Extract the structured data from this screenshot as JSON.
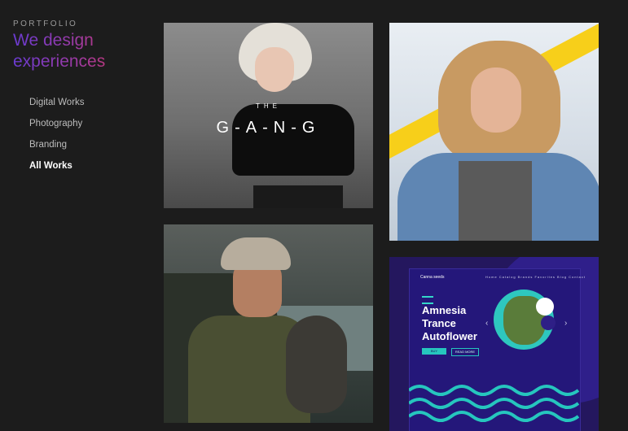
{
  "sidebar": {
    "eyebrow": "PORTFOLIO",
    "headline_line1": "We design",
    "headline_line2": "experiences",
    "nav": [
      {
        "label": "Digital Works",
        "active": false
      },
      {
        "label": "Photography",
        "active": false
      },
      {
        "label": "Branding",
        "active": false
      },
      {
        "label": "All Works",
        "active": true
      }
    ]
  },
  "tiles": {
    "gang": {
      "line1": "THE",
      "line2": "G-A-N-G"
    },
    "amnesia": {
      "brand": "Canna   seeds",
      "menu": "Home  Catalog  Brands  Favorites  Blog  Contact",
      "title_line1": "Amnesia",
      "title_line2": "Trance",
      "title_line3": "Autoflower",
      "btn_primary": "BUY",
      "btn_secondary": "READ MORE"
    }
  },
  "colors": {
    "background": "#1c1c1c",
    "gradient_start": "#6a3bd1",
    "gradient_end": "#e2354f",
    "accent_teal": "#26c6be"
  }
}
